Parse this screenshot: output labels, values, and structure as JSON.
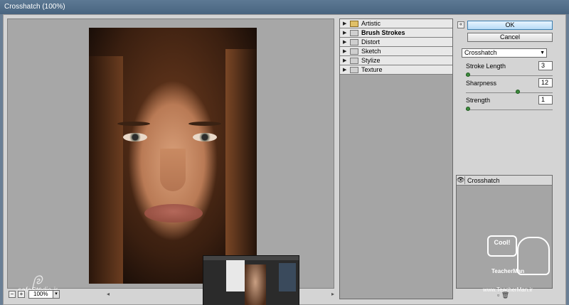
{
  "window": {
    "title": "Crosshatch (100%)"
  },
  "preview": {
    "zoom_value": "100%",
    "zoom_out_label": "−",
    "zoom_in_label": "+",
    "scroll_left": "◂",
    "scroll_right": "▸"
  },
  "filters": {
    "folders": [
      {
        "label": "Artistic"
      },
      {
        "label": "Brush Strokes"
      },
      {
        "label": "Distort"
      },
      {
        "label": "Sketch"
      },
      {
        "label": "Stylize"
      },
      {
        "label": "Texture"
      }
    ]
  },
  "controls": {
    "ok_label": "OK",
    "cancel_label": "Cancel",
    "collapse_glyph": "«",
    "filter_select": "Crosshatch",
    "params": [
      {
        "label": "Stroke Length",
        "value": "3",
        "fraction": 0.0
      },
      {
        "label": "Sharpness",
        "value": "12",
        "fraction": 0.6
      },
      {
        "label": "Strength",
        "value": "1",
        "fraction": 0.0
      }
    ]
  },
  "layers": {
    "items": [
      {
        "label": "Crosshatch"
      }
    ],
    "footer_new": "▫",
    "footer_delete": "🗑"
  },
  "watermarks": {
    "left_text": "safaStudio.ir",
    "right_badge": "Cool!",
    "right_caption": "TeacherMan",
    "right_url": "www.TeacherMan.ir"
  },
  "colors": {
    "ok_accent": "#3c7fb1",
    "folder": "#e0c068",
    "slider_knob": "#3d8a3d"
  }
}
